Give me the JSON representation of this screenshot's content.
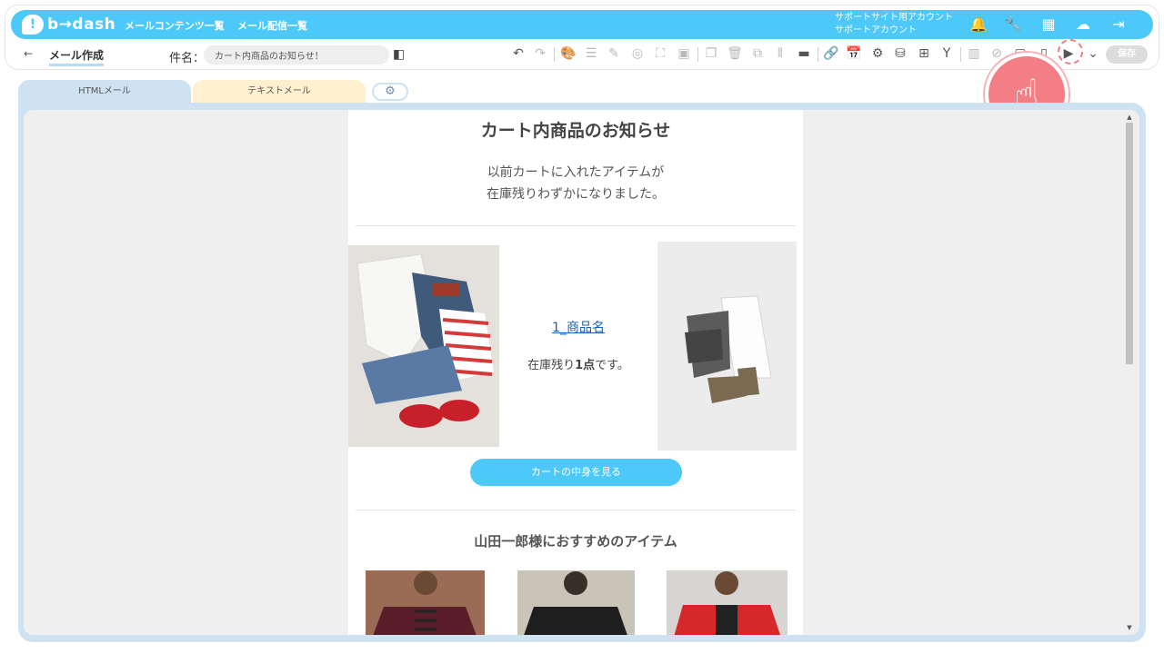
{
  "app": {
    "logo_mark": "!",
    "logo_text": "b→dash"
  },
  "nav": {
    "content_list": "メールコンテンツ一覧",
    "delivery_list": "メール配信一覧"
  },
  "account": {
    "line1": "サポートサイト用アカウント",
    "line2": "サポートアカウント"
  },
  "top_icons": [
    "bell-icon",
    "wrench-icon",
    "grid-icon",
    "brain-icon",
    "logout-icon"
  ],
  "toolbar": {
    "back_label": "←",
    "page_title": "メール作成",
    "subject_label": "件名：",
    "subject_value": "カート内商品のお知らせ！",
    "save_label": "保存"
  },
  "tabs": {
    "html": "HTMLメール",
    "text": "テキストメール",
    "settings_icon": "gear-icon"
  },
  "mail": {
    "title": "カート内商品のお知らせ",
    "lead_line1": "以前カートに入れたアイテムが",
    "lead_line2": "在庫残りわずかになりました。",
    "product_link": "1_商品名",
    "stock_prefix": "在庫残り",
    "stock_count": "1点",
    "stock_suffix": "です。",
    "cart_button": "カートの中身を見る",
    "recommend_title": "山田一郎様におすすめのアイテム"
  },
  "colors": {
    "accent": "#4cc9f9",
    "tab_html": "#cfe2f2",
    "tab_text": "#fff1cf",
    "pointer": "#f27e86"
  }
}
